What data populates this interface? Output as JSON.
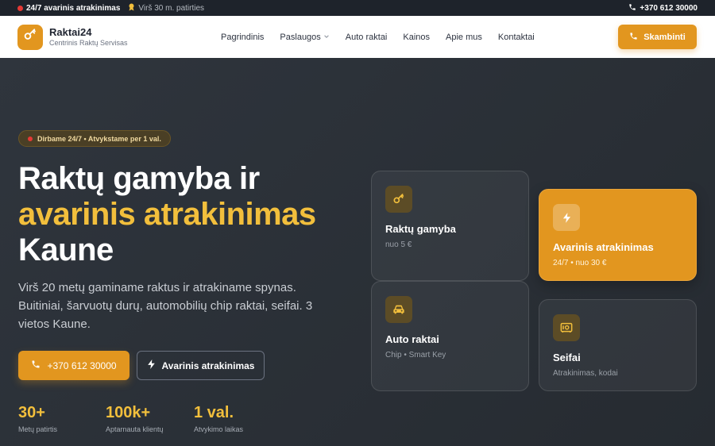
{
  "topbar": {
    "alert": "24/7 avarinis atrakinimas",
    "experience": "Virš 30 m. patirties",
    "phone": "+370 612 30000"
  },
  "header": {
    "brand_name": "Raktai24",
    "brand_sub": "Centrinis Raktų Servisas",
    "nav": [
      "Pagrindinis",
      "Paslaugos",
      "Auto raktai",
      "Kainos",
      "Apie mus",
      "Kontaktai"
    ],
    "cta": "Skambinti"
  },
  "hero": {
    "badge": "Dirbame 24/7 • Atvykstame per 1 val.",
    "title_line1": "Raktų gamyba ir",
    "title_accent": "avarinis atrakinimas",
    "title_line3": "Kaune",
    "lead": "Virš 20 metų gaminame raktus ir atrakiname spynas. Buitiniai, šarvuotų durų, automobilių chip raktai, seifai. 3 vietos Kaune.",
    "btn_phone": "+370 612 30000",
    "btn_emergency": "Avarinis atrakinimas",
    "stats": [
      {
        "value": "30+",
        "label": "Metų patirtis"
      },
      {
        "value": "100k+",
        "label": "Aptarnauta klientų"
      },
      {
        "value": "1 val.",
        "label": "Atvykimo laikas"
      }
    ]
  },
  "cards": [
    {
      "title": "Raktų gamyba",
      "sub": "nuo 5 €",
      "icon": "key-icon"
    },
    {
      "title": "Avarinis atrakinimas",
      "sub": "24/7 • nuo 30 €",
      "icon": "lightning-icon"
    },
    {
      "title": "Auto raktai",
      "sub": "Chip • Smart Key",
      "icon": "car-icon"
    },
    {
      "title": "Seifai",
      "sub": "Atrakinimas, kodai",
      "icon": "safe-icon"
    }
  ],
  "colors": {
    "accent": "#e2961f",
    "accent_text": "#f2bf3c",
    "alert_dot": "#e53935",
    "dark_bg": "#2b3036"
  }
}
